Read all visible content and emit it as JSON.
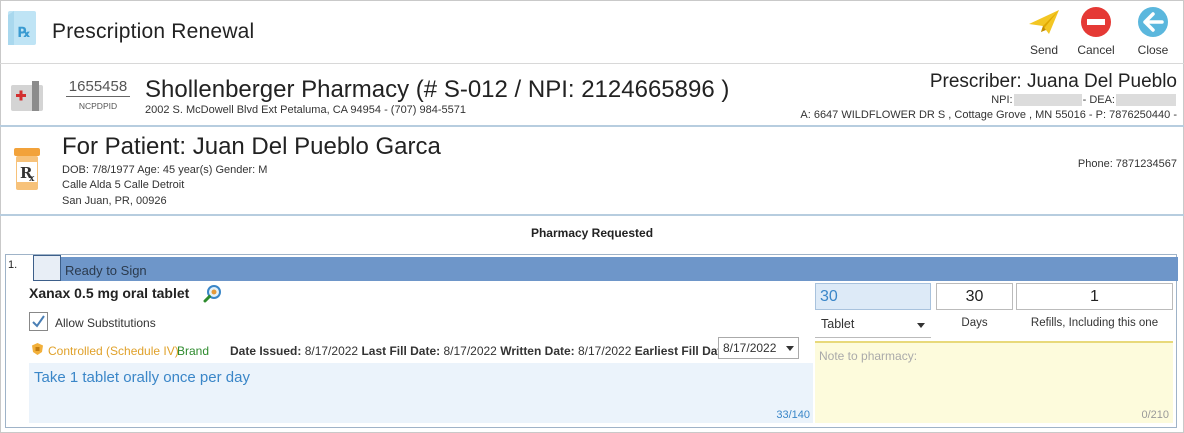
{
  "header": {
    "title": "Prescription Renewal",
    "send_label": "Send",
    "cancel_label": "Cancel",
    "close_label": "Close",
    "colors": {
      "send": "#f3c623",
      "cancel": "#e53935",
      "close": "#5bb7dd"
    }
  },
  "pharmacy": {
    "ncpdp_id": "1655458",
    "ncpdp_label": "NCPDPID",
    "name": "Shollenberger Pharmacy  (# S-012  / NPI:  2124665896 )",
    "address": "2002 S. McDowell Blvd Ext Petaluma, CA 94954 - (707) 984-5571"
  },
  "prescriber": {
    "name": "Prescriber: Juana Del Pueblo",
    "npi_label": "NPI:",
    "dea_label": "- DEA:",
    "address": "A:  6647 WILDFLOWER DR S  ,  Cottage Grove ,  MN 55016  - P: 7876250440  -"
  },
  "patient": {
    "name": "For Patient:  Juan Del Pueblo Garca",
    "demographics": "DOB:  7/8/1977  Age:  45 year(s)  Gender:  M",
    "address_line1": "Calle Alda 5 Calle Detroit",
    "address_line2": "San Juan, PR, 00926",
    "phone": "Phone:  7871234567"
  },
  "section_title": "Pharmacy Requested",
  "item": {
    "number": "1.",
    "status_label": "Ready to Sign",
    "drug": "Xanax 0.5 mg oral tablet",
    "allow_substitutions_label": "Allow Substitutions",
    "allow_substitutions_checked": true,
    "controlled_label": "Controlled (Schedule IV)",
    "brand_label": "Brand",
    "date_issued_label": "Date Issued:",
    "date_issued": "8/17/2022",
    "last_fill_label": "Last Fill Date:",
    "last_fill": "8/17/2022",
    "written_label": "Written Date:",
    "written": "8/17/2022",
    "earliest_fill_label": "Earliest Fill Date:",
    "earliest_fill": "8/17/2022",
    "sig": "Take 1 tablet orally once per day",
    "sig_count": "33/140",
    "quantity": "30",
    "unit": "Tablet",
    "days": "30",
    "days_label": "Days",
    "refills": "1",
    "refills_label": "Refills, Including this one",
    "note_placeholder": "Note to pharmacy:",
    "note_count": "0/210"
  }
}
